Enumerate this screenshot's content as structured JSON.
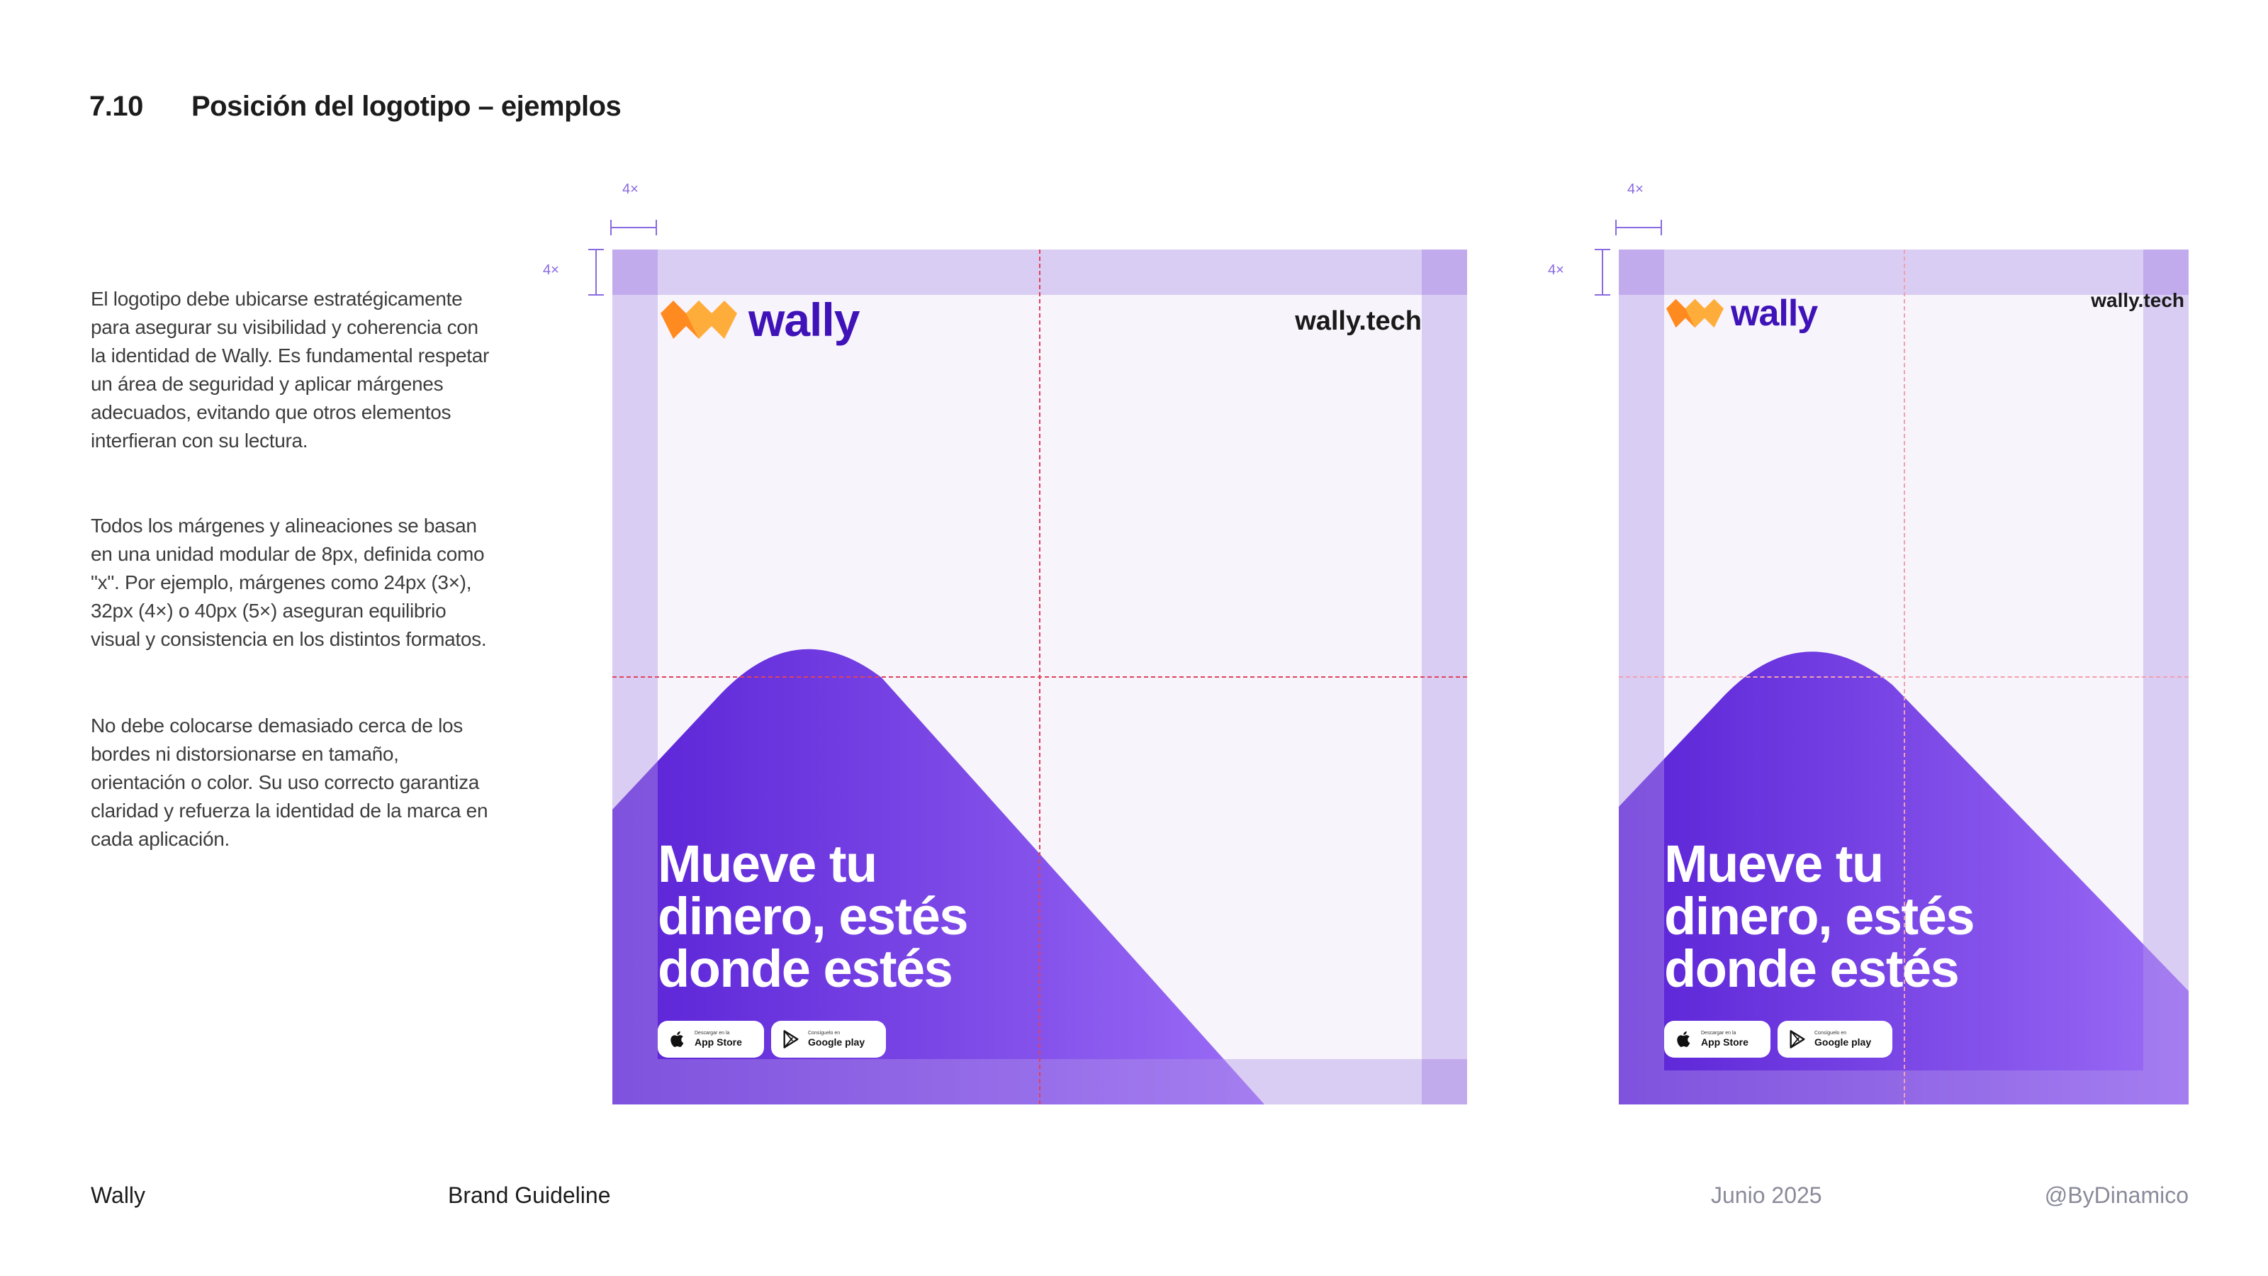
{
  "header": {
    "section_number": "7.10",
    "section_title": "Posición del logotipo – ejemplos"
  },
  "body": {
    "paragraphs": [
      "El logotipo debe ubicarse estratégicamente para asegurar su visibilidad y coherencia con la identidad de Wally. Es fundamental respetar un área de seguridad y aplicar márgenes adecuados, evitando que otros elementos interfieran con su lectura.",
      "Todos los márgenes y alineaciones se basan en una unidad modular de 8px, definida como \"x\". Por ejemplo, márgenes como 24px (3×), 32px (4×) o 40px (5×) aseguran equilibrio visual y consistencia en los distintos formatos.",
      "No debe colocarse demasiado cerca de los bordes ni distorsionarse en tamaño, orientación o color. Su uso correcto garantiza claridad y refuerza la identidad de la marca en cada aplicación."
    ]
  },
  "examples": [
    {
      "margin_label_top": "4×",
      "margin_label_left": "4×",
      "brand_name": "wally",
      "domain": "wally.tech",
      "headline": [
        "Mueve tu",
        "dinero, estés",
        "donde estés"
      ],
      "app_store": {
        "small": "Descargar en la",
        "label": "App Store"
      },
      "google_play": {
        "small": "Consíguelo en",
        "label": "Google play"
      }
    },
    {
      "margin_label_top": "4×",
      "margin_label_left": "4×",
      "brand_name": "wally",
      "domain": "wally.tech",
      "headline": [
        "Mueve tu",
        "dinero, estés",
        "donde estés"
      ],
      "app_store": {
        "small": "Descargar en la",
        "label": "App Store"
      },
      "google_play": {
        "small": "Consíguelo en",
        "label": "Google play"
      }
    }
  ],
  "footer": {
    "brand": "Wally",
    "document": "Brand Guideline",
    "date": "Junio 2025",
    "handle": "@ByDinamico"
  },
  "colors": {
    "brand_purple": "#3f13b8",
    "gradient_start": "#5a22d6",
    "gradient_end": "#9b6cf6",
    "margin_band": "#cdbdf0",
    "guide_red": "#e0425a",
    "logo_orange": "#ff8a1f"
  }
}
